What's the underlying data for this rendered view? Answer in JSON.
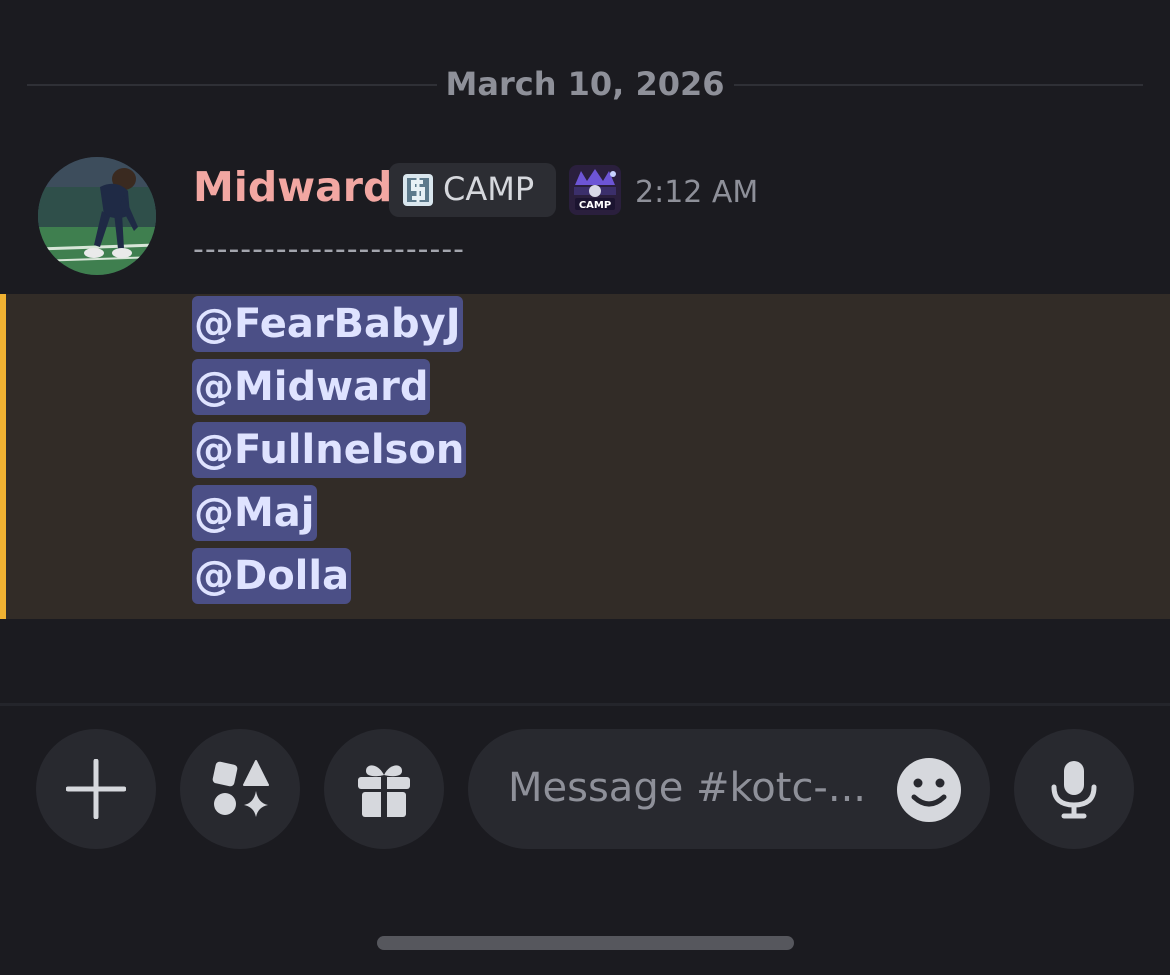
{
  "date_divider": {
    "text": "March 10, 2026"
  },
  "message": {
    "author": "Midward",
    "role_tag": {
      "icon": "dollar-sign-badge-icon",
      "label": "CAMP"
    },
    "badge": {
      "icon": "majik-elite-camp-badge-icon",
      "text": "CAMP"
    },
    "timestamp": "2:12 AM",
    "separator": "-----------------------",
    "mentions": [
      "@FearBabyJ",
      "@Midward",
      "@Fullnelson",
      "@Maj",
      "@Dolla"
    ]
  },
  "composer": {
    "add_icon": "plus-icon",
    "apps_icon": "apps-icon",
    "gift_icon": "gift-icon",
    "placeholder": "Message #kotc-...",
    "emoji_icon": "emoji-icon",
    "mic_icon": "microphone-icon"
  },
  "colors": {
    "background": "#1b1b20",
    "author": "#f2a7a2",
    "mention_bg": "#4b4f86",
    "mention_text": "#dfe3ff",
    "highlight_bg": "#322c27",
    "highlight_bar": "#f0b232"
  }
}
